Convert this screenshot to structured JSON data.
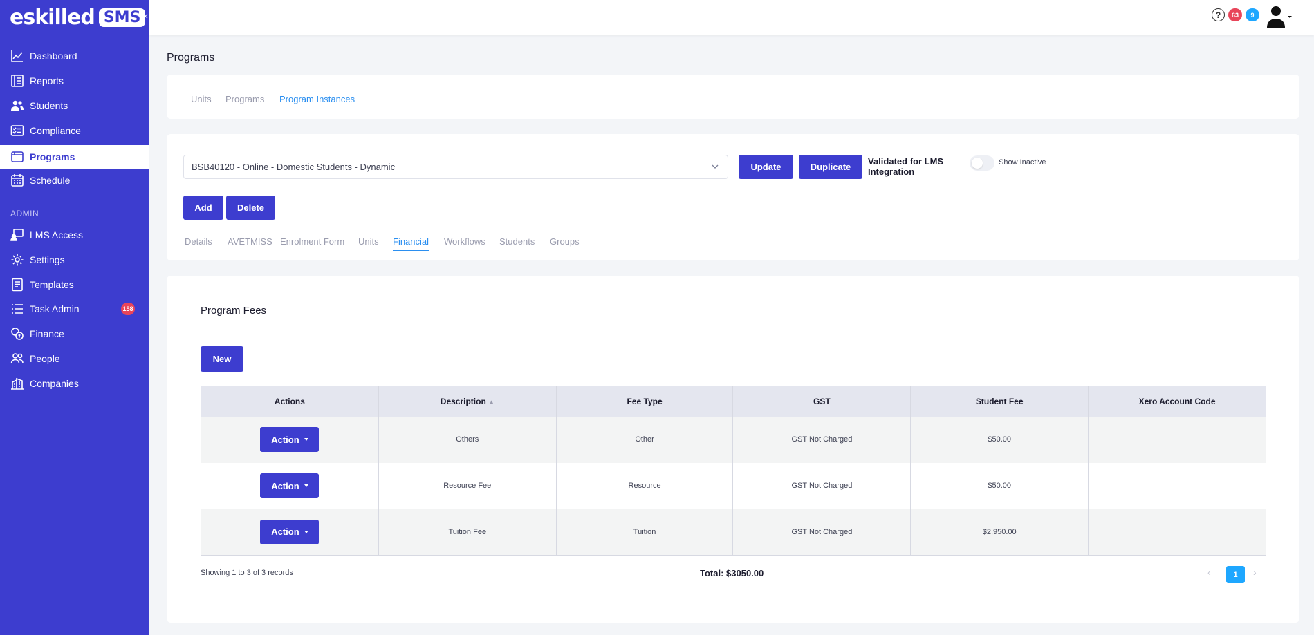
{
  "app": {
    "logo_text": "eskilled",
    "logo_badge": "SMS",
    "collapse_icon": "«"
  },
  "sidebar": {
    "items": [
      {
        "label": "Dashboard",
        "icon": "chart-line-icon"
      },
      {
        "label": "Reports",
        "icon": "report-icon"
      },
      {
        "label": "Students",
        "icon": "users-icon"
      },
      {
        "label": "Compliance",
        "icon": "checklist-icon"
      },
      {
        "label": "Programs",
        "icon": "window-icon",
        "active": true
      },
      {
        "label": "Schedule",
        "icon": "calendar-icon"
      }
    ],
    "admin_section": "ADMIN",
    "admin_items": [
      {
        "label": "LMS Access",
        "icon": "lms-icon"
      },
      {
        "label": "Settings",
        "icon": "gear-icon"
      },
      {
        "label": "Templates",
        "icon": "document-icon"
      },
      {
        "label": "Task Admin",
        "icon": "tasks-icon",
        "badge": "158"
      },
      {
        "label": "Finance",
        "icon": "coins-icon"
      },
      {
        "label": "People",
        "icon": "people-icon"
      },
      {
        "label": "Companies",
        "icon": "buildings-icon"
      }
    ]
  },
  "topbar": {
    "help_icon": "?",
    "badge_red": "63",
    "badge_blue": "9"
  },
  "page": {
    "title": "Programs",
    "tabs": [
      "Units",
      "Programs",
      "Program Instances"
    ],
    "active_tab": "Program Instances"
  },
  "instance": {
    "selected": "BSB40120 - Online - Domestic Students - Dynamic",
    "update_label": "Update",
    "duplicate_label": "Duplicate",
    "validated_label": "Validated for LMS Integration",
    "show_inactive_label": "Show Inactive",
    "add_label": "Add",
    "delete_label": "Delete",
    "subtabs": [
      "Details",
      "AVETMISS",
      "Enrolment Form",
      "Units",
      "Financial",
      "Workflows",
      "Students",
      "Groups"
    ],
    "active_subtab": "Financial"
  },
  "fees": {
    "title": "Program Fees",
    "new_label": "New",
    "columns": [
      "Actions",
      "Description",
      "Fee Type",
      "GST",
      "Student Fee",
      "Xero Account Code"
    ],
    "rows": [
      {
        "action": "Action",
        "description": "Others",
        "fee_type": "Other",
        "gst": "GST Not Charged",
        "student_fee": "$50.00",
        "xero": ""
      },
      {
        "action": "Action",
        "description": "Resource Fee",
        "fee_type": "Resource",
        "gst": "GST Not Charged",
        "student_fee": "$50.00",
        "xero": ""
      },
      {
        "action": "Action",
        "description": "Tuition Fee",
        "fee_type": "Tuition",
        "gst": "GST Not Charged",
        "student_fee": "$2,950.00",
        "xero": ""
      }
    ],
    "showing": "Showing 1 to 3 of 3 records",
    "total": "Total: $3050.00",
    "page_current": "1",
    "prev": "‹",
    "next": "›"
  },
  "colors": {
    "brand": "#3d3dcf",
    "link_active": "#2b8ff0",
    "badge_red": "#e8455a",
    "badge_blue": "#1ea7ff"
  }
}
